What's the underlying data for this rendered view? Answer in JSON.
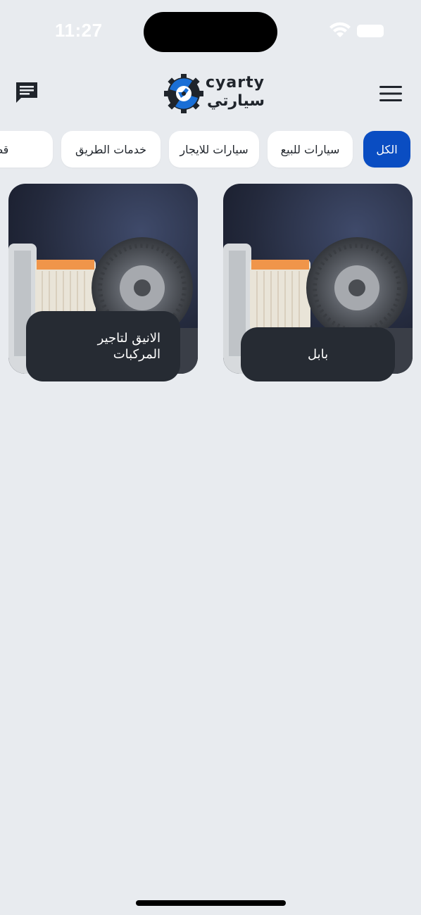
{
  "status_bar": {
    "time": "11:27",
    "icons": [
      "wifi-icon",
      "battery-icon"
    ]
  },
  "header": {
    "logo_latin": "cyarty",
    "logo_arabic": "سيارتي",
    "left_icon": "chat-icon",
    "right_icon": "menu-icon"
  },
  "categories": [
    {
      "label": "الكل",
      "active": true
    },
    {
      "label": "سيارات للبيع",
      "active": false
    },
    {
      "label": "سيارات للايجار",
      "active": false
    },
    {
      "label": "خدمات الطريق",
      "active": false
    },
    {
      "label": "قطع الغ",
      "active": false
    }
  ],
  "cards": [
    {
      "title": "بابل",
      "image": "auto-parts-photo"
    },
    {
      "title": "الانيق لتاجير المركبات",
      "image": "auto-parts-photo"
    }
  ],
  "colors": {
    "background": "#e8ebef",
    "accent": "#0a4dc2",
    "card_label_bg": "#262b33",
    "logo_blue": "#1a6fd6"
  }
}
